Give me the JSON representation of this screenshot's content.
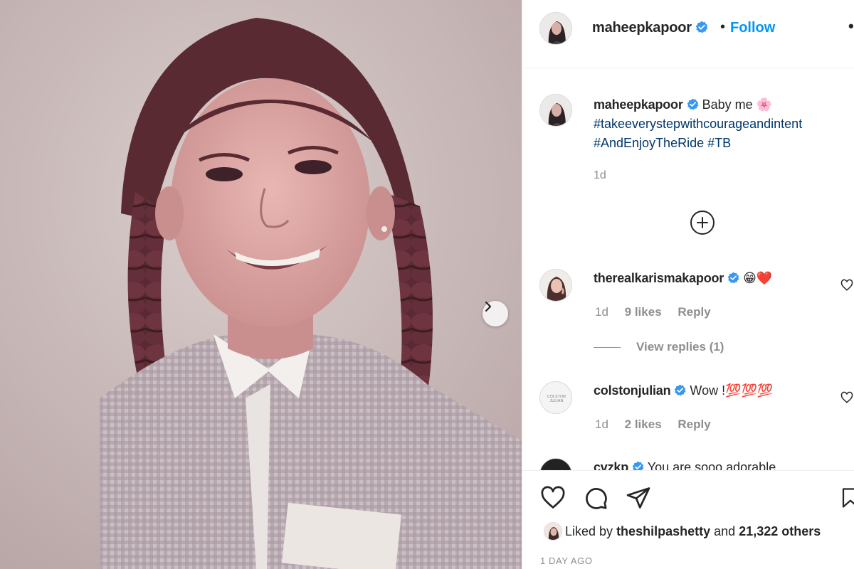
{
  "header": {
    "username": "maheepkapoor",
    "separator": "•",
    "follow_label": "Follow",
    "more_label": "•••"
  },
  "caption": {
    "username": "maheepkapoor",
    "text": "Baby me",
    "emoji": "🌸",
    "hashtags": [
      "#takeeverystepwithcourageandintent",
      "#AndEnjoyTheRide",
      "#TB"
    ],
    "time": "1d"
  },
  "comments": [
    {
      "username": "therealkarismakapoor",
      "text": "😁❤️",
      "time": "1d",
      "likes": "9 likes",
      "reply_label": "Reply",
      "view_replies": "View replies (1)"
    },
    {
      "username": "colstonjulian",
      "text": "Wow !💯💯💯",
      "time": "1d",
      "likes": "2 likes",
      "reply_label": "Reply",
      "avatar_text": "COLSTON JULIAN"
    },
    {
      "username": "cvzkp",
      "text": "You are sooo adorable"
    }
  ],
  "actions": {
    "liked_by_prefix": "Liked by",
    "liked_by_user": "theshilpashetty",
    "liked_by_and": "and",
    "liked_by_count": "21,322 others",
    "post_time": "1 DAY AGO"
  },
  "icons": {
    "verified": "verified-badge-icon",
    "carousel_next": "chevron-right-icon",
    "load_more": "plus-circle-icon",
    "like": "heart-icon",
    "comment": "comment-bubble-icon",
    "share": "paper-plane-icon",
    "save": "bookmark-icon"
  },
  "colors": {
    "accent": "#0095f6",
    "verified": "#3897f0",
    "hashtag": "#00376b",
    "muted": "#8e8e8e"
  }
}
